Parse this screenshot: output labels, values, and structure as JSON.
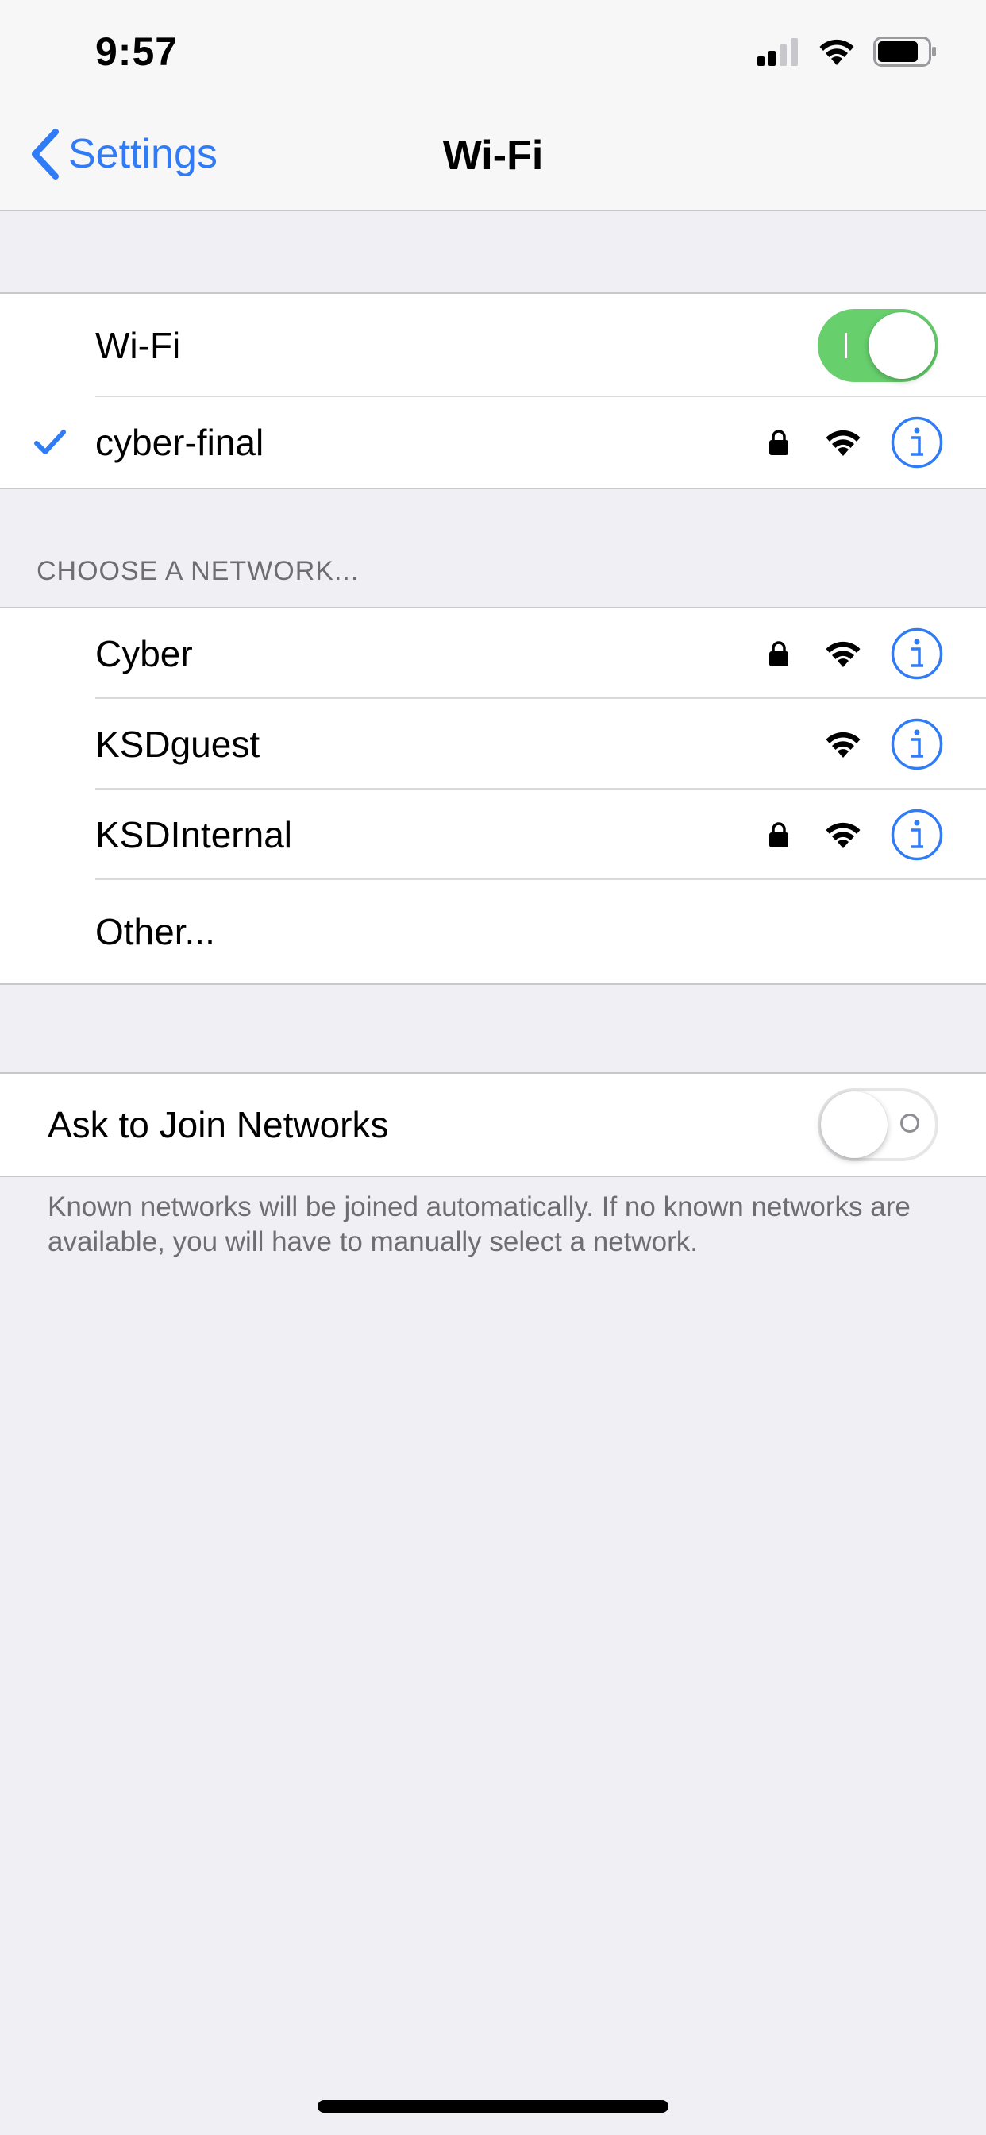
{
  "status_bar": {
    "time": "9:57",
    "icons": [
      "cellular-signal-icon",
      "wifi-icon",
      "battery-icon"
    ]
  },
  "nav": {
    "back_label": "Settings",
    "title": "Wi-Fi"
  },
  "wifi_section": {
    "toggle_label": "Wi-Fi",
    "toggle_on": true,
    "connected_network": {
      "name": "cyber-final",
      "locked": true,
      "selected": true
    }
  },
  "networks_section": {
    "header": "CHOOSE A NETWORK...",
    "networks": [
      {
        "name": "Cyber",
        "locked": true
      },
      {
        "name": "KSDguest",
        "locked": false
      },
      {
        "name": "KSDInternal",
        "locked": true
      }
    ],
    "other_label": "Other..."
  },
  "ask_section": {
    "label": "Ask to Join Networks",
    "toggle_on": false,
    "footnote": "Known networks will be joined automatically. If no known networks are available, you will have to manually select a network."
  },
  "colors": {
    "accent": "#2f7cf6",
    "toggle_on": "#67d06d",
    "background": "#efeff4",
    "secondary_text": "#6d6d72"
  }
}
